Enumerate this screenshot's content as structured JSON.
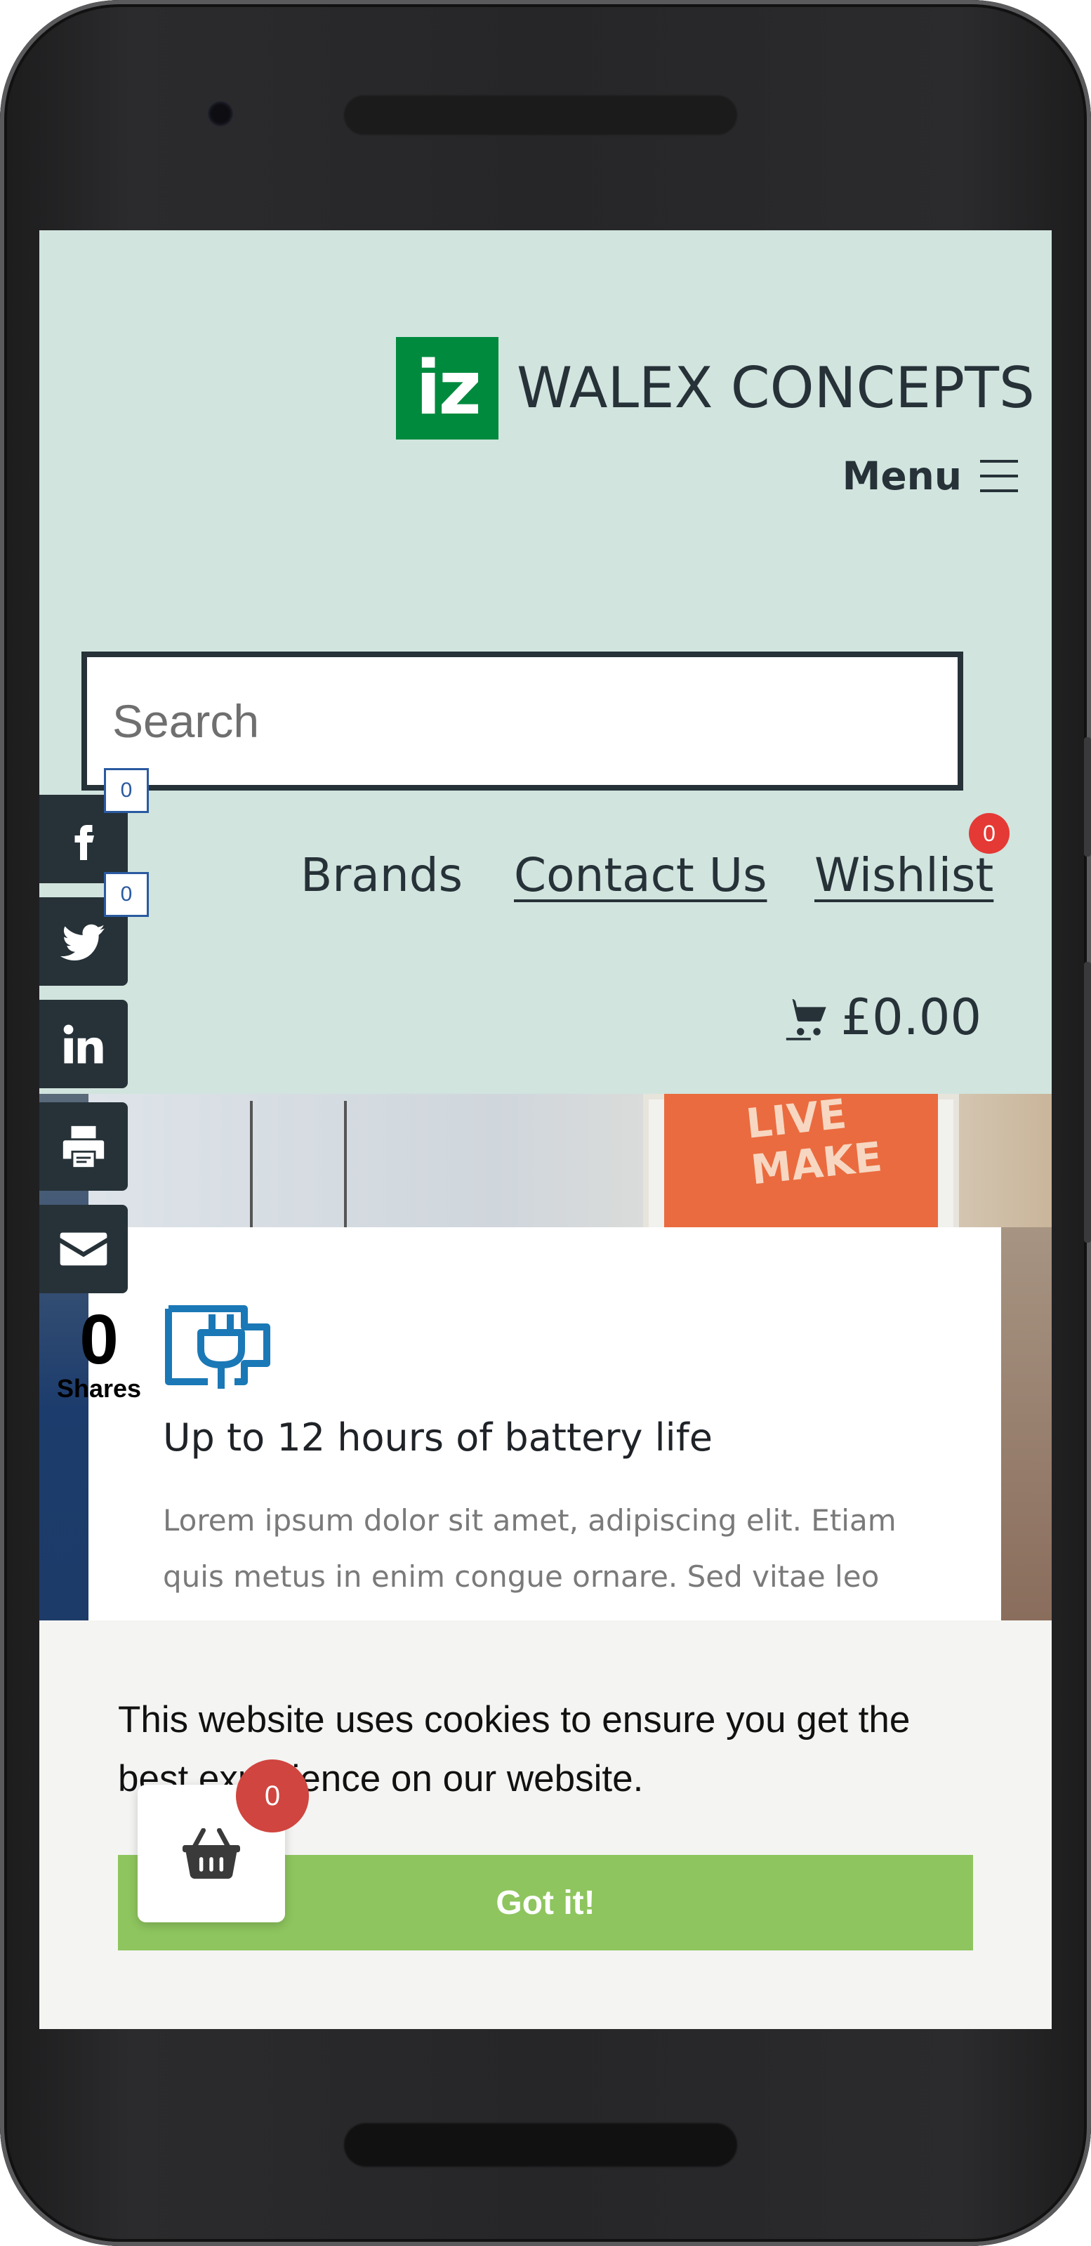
{
  "site": {
    "logo_text": "iz",
    "brand_name": "WALEX CONCEPTS",
    "menu_label": "Menu"
  },
  "search": {
    "placeholder": "Search",
    "value": ""
  },
  "nav": {
    "brands": "Brands",
    "contact": "Contact Us",
    "wishlist": "Wishlist",
    "wishlist_count": "0"
  },
  "cart": {
    "total": "£0.00",
    "mini_cart_count": "0"
  },
  "share": {
    "facebook_count": "0",
    "twitter_count": "0",
    "total": "0",
    "total_label": "Shares",
    "icons": [
      "facebook-icon",
      "twitter-icon",
      "linkedin-icon",
      "print-icon",
      "email-icon"
    ]
  },
  "hero": {
    "poster_text": "LIVE\nMAKE"
  },
  "feature": {
    "icon": "battery-plug-icon",
    "title": "Up to 12 hours of battery life",
    "text": "Lorem ipsum dolor sit amet, adipiscing elit. Etiam quis metus in enim congue ornare. Sed vitae leo"
  },
  "cookie": {
    "message": "This website uses cookies to ensure you get the best experience on our website.",
    "button": "Got it!"
  },
  "colors": {
    "header_bg": "#d1e4de",
    "text_dark": "#263238",
    "logo_green": "#008a3e",
    "badge_red": "#e53935",
    "cookie_button": "#8ec55e",
    "icon_blue": "#1b78b6"
  }
}
